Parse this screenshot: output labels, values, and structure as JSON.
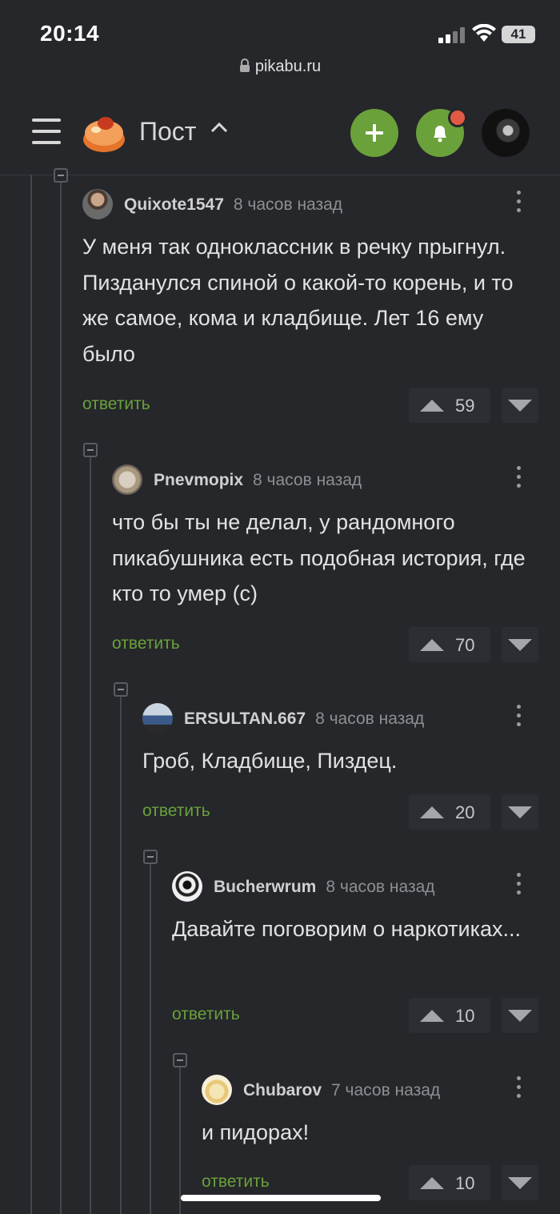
{
  "status_bar": {
    "time": "20:14",
    "battery": "41"
  },
  "browser": {
    "url": "pikabu.ru"
  },
  "header": {
    "title": "Пост"
  },
  "comments": [
    {
      "user": "Quixote1547",
      "time": "8 часов назад",
      "text": "У меня так одноклассник в речку прыгнул. Пизданулся спиной о какой-то корень, и то же самое, кома и кладбище. Лет 16 ему было",
      "reply": "ответить",
      "rating": "59"
    },
    {
      "user": "Pnevmopix",
      "time": "8 часов назад",
      "text": "что бы ты не делал, у рандомного пикабушника есть подобная история, где кто то умер (с)",
      "reply": "ответить",
      "rating": "70"
    },
    {
      "user": "ERSULTAN.667",
      "time": "8 часов назад",
      "text": "Гроб, Кладбище, Пиздец.",
      "reply": "ответить",
      "rating": "20"
    },
    {
      "user": "Bucherwrum",
      "time": "8 часов назад",
      "text": "Давайте поговорим о наркотиках...",
      "reply": "ответить",
      "rating": "10"
    },
    {
      "user": "Chubarov",
      "time": "7 часов назад",
      "text": "и пидорах!",
      "reply": "ответить",
      "rating": "10"
    }
  ]
}
